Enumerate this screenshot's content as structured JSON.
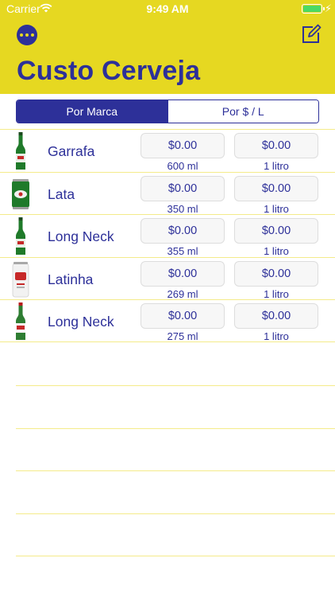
{
  "status_bar": {
    "carrier": "Carrier",
    "time": "9:49 AM"
  },
  "header": {
    "title": "Custo Cerveja",
    "more_icon": "more-icon",
    "compose_icon": "compose-icon"
  },
  "colors": {
    "accent": "#2d3099",
    "header_bg": "#e6d821",
    "divider": "#f4eb8a"
  },
  "segments": [
    {
      "label": "Por Marca",
      "selected": true
    },
    {
      "label": "Por $ / L",
      "selected": false
    }
  ],
  "rows": [
    {
      "icon": "green-bottle-icon",
      "name": "Garrafa",
      "price": "$0.00",
      "volume": "600 ml",
      "price_per_liter": "$0.00",
      "per_unit": "1 litro"
    },
    {
      "icon": "green-can-icon",
      "name": "Lata",
      "price": "$0.00",
      "volume": "350 ml",
      "price_per_liter": "$0.00",
      "per_unit": "1 litro"
    },
    {
      "icon": "green-bottle-icon",
      "name": "Long Neck",
      "price": "$0.00",
      "volume": "355 ml",
      "price_per_liter": "$0.00",
      "per_unit": "1 litro"
    },
    {
      "icon": "white-can-icon",
      "name": "Latinha",
      "price": "$0.00",
      "volume": "269 ml",
      "price_per_liter": "$0.00",
      "per_unit": "1 litro"
    },
    {
      "icon": "red-label-bottle-icon",
      "name": "Long Neck",
      "price": "$0.00",
      "volume": "275 ml",
      "price_per_liter": "$0.00",
      "per_unit": "1 litro"
    }
  ]
}
